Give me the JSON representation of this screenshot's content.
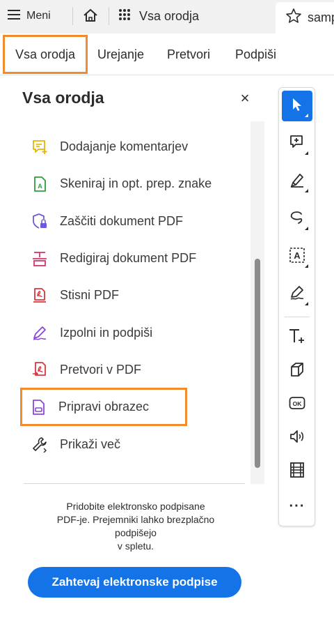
{
  "topbar": {
    "menu_label": "Meni",
    "tools_label": "Vsa orodja",
    "doc_tab_label": "samp"
  },
  "categories": [
    {
      "label": "Vsa orodja",
      "active": true
    },
    {
      "label": "Urejanje"
    },
    {
      "label": "Pretvori"
    },
    {
      "label": "Podpiši"
    }
  ],
  "panel": {
    "title": "Vsa orodja",
    "close_glyph": "×",
    "tools": [
      {
        "label": "Dodajanje komentarjev",
        "icon": "comment-icon",
        "color": "#e8b200"
      },
      {
        "label": "Skeniraj in opt. prep. znake",
        "icon": "scan-ocr-icon",
        "color": "#2d9d3c"
      },
      {
        "label": "Zaščiti dokument PDF",
        "icon": "protect-icon",
        "color": "#6b5bd6"
      },
      {
        "label": "Redigiraj dokument PDF",
        "icon": "redact-icon",
        "color": "#d6336c"
      },
      {
        "label": "Stisni PDF",
        "icon": "compress-icon",
        "color": "#d7373f"
      },
      {
        "label": "Izpolni in podpiši",
        "icon": "fill-sign-icon",
        "color": "#8847d8"
      },
      {
        "label": "Pretvori v PDF",
        "icon": "convert-pdf-icon",
        "color": "#d7373f"
      },
      {
        "label": "Pripravi obrazec",
        "icon": "prepare-form-icon",
        "color": "#8847d8"
      },
      {
        "label": "Prikaži več",
        "icon": "wrench-icon",
        "color": "#2c2c2c"
      }
    ],
    "promo_lines": [
      "Pridobite elektronsko podpisane",
      "PDF-je. Prejemniki lahko brezplačno",
      "podpišejo",
      "v spletu."
    ],
    "promo_button": "Zahtevaj elektronske podpise"
  },
  "vtoolbar": {
    "items": [
      "select-icon",
      "add-comment-icon",
      "highlight-icon",
      "draw-icon",
      "text-select-icon",
      "fill-sign-icon",
      "add-text-icon",
      "3d-box-icon",
      "ok-button-icon",
      "sound-icon",
      "video-icon",
      "more-icon"
    ],
    "more_glyph": "···"
  },
  "colors": {
    "accent_blue": "#1473e6",
    "highlight_orange": "#f28a2e"
  }
}
